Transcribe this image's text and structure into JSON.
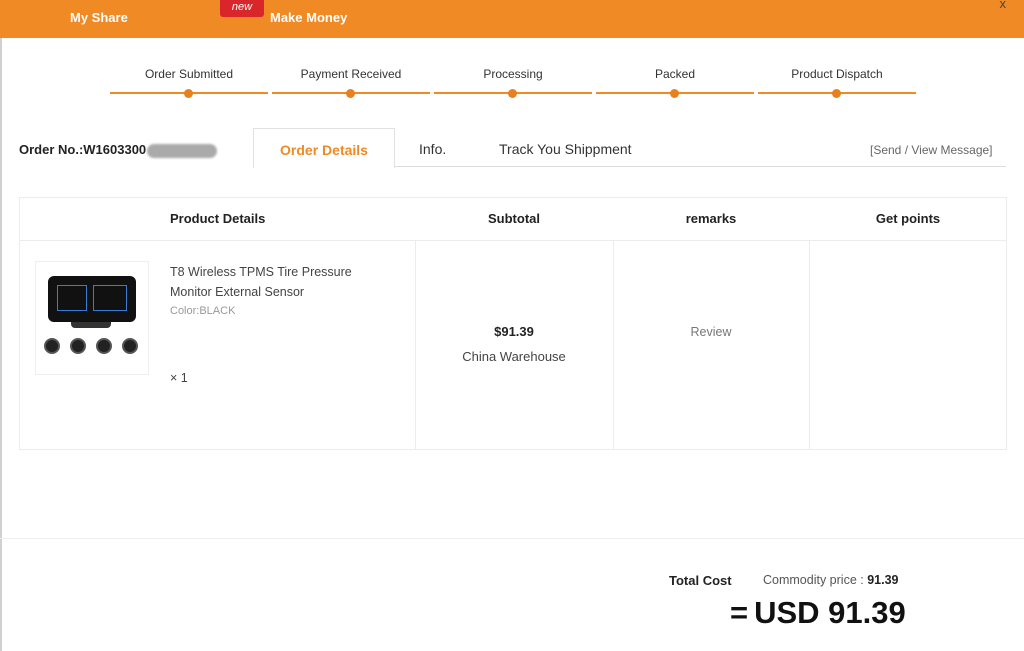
{
  "header": {
    "my_share": "My Share",
    "new_badge": "new",
    "make_money": "Make Money",
    "close": "x"
  },
  "progress_steps": [
    {
      "label": "Order Submitted"
    },
    {
      "label": "Payment Received"
    },
    {
      "label": "Processing"
    },
    {
      "label": "Packed"
    },
    {
      "label": "Product Dispatch"
    }
  ],
  "order": {
    "number_prefix": "Order No.:W1603300"
  },
  "tabs": [
    {
      "label": "Order Details",
      "active": true
    },
    {
      "label": "Info."
    },
    {
      "label": "Track You Shippment"
    }
  ],
  "send_message": "[Send / View Message]",
  "table": {
    "headers": {
      "product": "Product Details",
      "subtotal": "Subtotal",
      "remarks": "remarks",
      "points": "Get points"
    },
    "rows": [
      {
        "title": "T8 Wireless TPMS Tire Pressure Monitor External Sensor",
        "color": "Color:BLACK",
        "quantity": "× 1",
        "price": "$91.39",
        "warehouse": "China Warehouse",
        "remarks_action": "Review"
      }
    ]
  },
  "totals": {
    "total_cost_label": "Total Cost",
    "commodity_label": "Commodity price :",
    "commodity_value": "91.39",
    "equals": "=",
    "grand_total": "USD 91.39"
  },
  "colors": {
    "accent": "#f08a24",
    "badge": "#d9262b"
  }
}
